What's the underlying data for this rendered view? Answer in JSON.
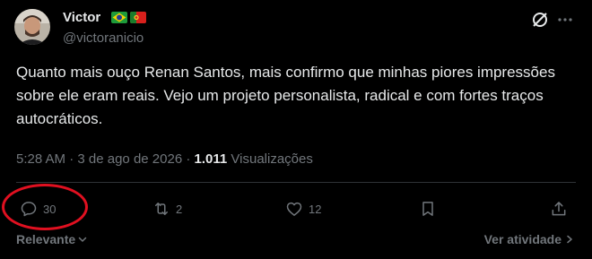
{
  "author": {
    "display_name": "Victor",
    "handle": "@victoranicio",
    "flags": [
      "brazil-flag",
      "portugal-flag"
    ]
  },
  "tweet": {
    "text": "Quanto mais ouço Renan Santos, mais confirmo que minhas piores impressões sobre ele eram reais. Vejo um projeto personalista, radical e com fortes traços autocráticos.",
    "time": "5:28 AM",
    "date": "3 de ago de 2026",
    "views_count": "1.011",
    "views_label": "Visualizações"
  },
  "actions": {
    "reply_count": "30",
    "retweet_count": "2",
    "like_count": "12"
  },
  "footer": {
    "sort_label": "Relevante",
    "activity_label": "Ver atividade"
  },
  "annotation": {
    "highlight_color": "#e01020"
  }
}
